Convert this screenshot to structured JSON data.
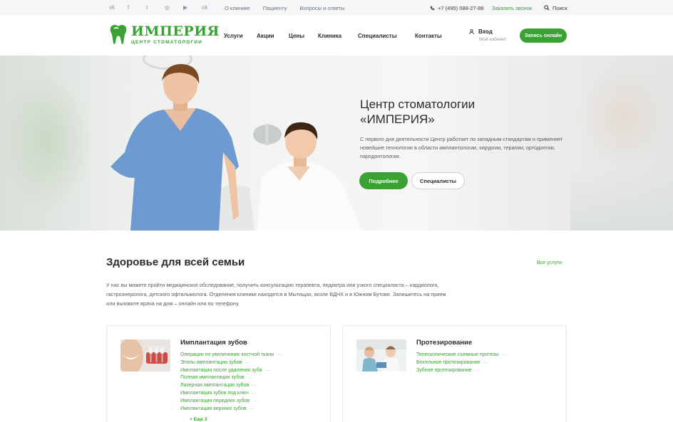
{
  "topbar": {
    "social": [
      {
        "name": "vk-icon",
        "glyph": "vk"
      },
      {
        "name": "facebook-icon",
        "glyph": "f"
      },
      {
        "name": "twitter-icon",
        "glyph": "t"
      },
      {
        "name": "instagram-icon",
        "glyph": "◎"
      },
      {
        "name": "youtube-icon",
        "glyph": "▶"
      },
      {
        "name": "odnoklassniki-icon",
        "glyph": "ok"
      }
    ],
    "links": [
      "О клинике",
      "Пациенту",
      "Вопросы и ответы"
    ],
    "phone": "+7 (495) 088-27-88",
    "callback": "Заказать звонок",
    "search": "Поиск"
  },
  "header": {
    "logo_main": "ИМПЕРИЯ",
    "logo_sub": "ЦЕНТР СТОМАТОЛОГИИ",
    "nav": [
      "Услуги",
      "Акции",
      "Цены",
      "Клиника",
      "Специалисты",
      "Контакты"
    ],
    "login": "Вход",
    "login_sub": "Мой кабинет",
    "record_button": "Запись онлайн"
  },
  "hero": {
    "title": "Центр стоматологии «ИМПЕРИЯ»",
    "text": "С первого дня деятельности Центр работает по западным стандартам и применяет новейшие технологии в области имплантологии, хирургии, терапии, ортодонтии, пародонтологии.",
    "btn_more": "Подробнее",
    "btn_specialists": "Специалисты"
  },
  "section": {
    "title": "Здоровье для всей семьи",
    "all_services": "Все услуги",
    "text": "У нас вы можете пройти медицинское обследование, получить консультацию терапевта, педиатра или узкого специалиста – кардиолога, гастроэнеролога, детского офтальмолога. Отделения клиники находятся в Мытищах, возле ВДНХ и в Южном Бутове. Запишитесь на прием или вызовите врача на дом – онлайн или по телефону."
  },
  "cards": [
    {
      "title": "Имплантация зубов",
      "items": [
        "Операции по увеличению костной ткани",
        "Этапы имплантации зубов",
        "Имплантация после удаления зуба",
        "Полная имплантация зубов",
        "Лазерная имплантация зубов",
        "Имплантация зубов под ключ",
        "Имплантация передних зубов",
        "Имплантация верхних зубов"
      ],
      "more": "+ Еще 3"
    },
    {
      "title": "Протезирование",
      "items": [
        "Телескопические съемные протезы",
        "Бюгельное протезирование",
        "Зубное протезирование"
      ]
    }
  ],
  "colors": {
    "accent": "#3aa133",
    "topbar_bg": "#f5f6f7",
    "text": "#2b2b2b"
  }
}
